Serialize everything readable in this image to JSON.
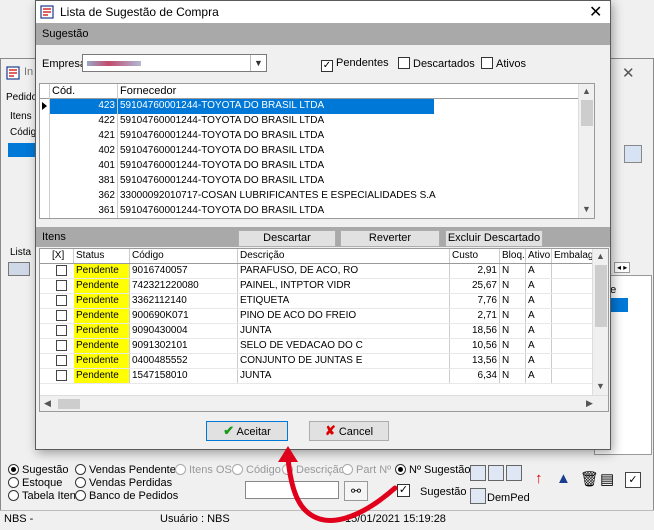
{
  "dialog": {
    "title": "Lista de Sugestão de Compra",
    "close_glyph": "✕"
  },
  "sugestao_section": {
    "label": "Sugestão",
    "empresa_label": "Empresa",
    "checkboxes": [
      {
        "label": "Pendentes",
        "checked": true
      },
      {
        "label": "Descartados",
        "checked": false
      },
      {
        "label": "Ativos",
        "checked": false
      }
    ]
  },
  "sugestoes_grid": {
    "columns": [
      "Cód. Sugestão",
      "Fornecedor"
    ],
    "rows": [
      {
        "cod": "423",
        "fornecedor": "59104760001244-TOYOTA DO BRASIL LTDA",
        "selected": true
      },
      {
        "cod": "422",
        "fornecedor": "59104760001244-TOYOTA DO BRASIL LTDA",
        "selected": false
      },
      {
        "cod": "421",
        "fornecedor": "59104760001244-TOYOTA DO BRASIL LTDA",
        "selected": false
      },
      {
        "cod": "402",
        "fornecedor": "59104760001244-TOYOTA DO BRASIL LTDA",
        "selected": false
      },
      {
        "cod": "401",
        "fornecedor": "59104760001244-TOYOTA DO BRASIL LTDA",
        "selected": false
      },
      {
        "cod": "381",
        "fornecedor": "59104760001244-TOYOTA DO BRASIL LTDA",
        "selected": false
      },
      {
        "cod": "362",
        "fornecedor": "33000092010717-COSAN LUBRIFICANTES E ESPECIALIDADES S.A",
        "selected": false
      },
      {
        "cod": "361",
        "fornecedor": "59104760001244-TOYOTA DO BRASIL LTDA",
        "selected": false
      }
    ]
  },
  "itens_section": {
    "label": "Itens",
    "buttons": {
      "descartar": "Descartar",
      "reverter": "Reverter Descartado",
      "excluir": "Excluir Descartado"
    }
  },
  "itens_grid": {
    "columns": [
      "[X]",
      "Status",
      "Código",
      "Descrição",
      "Custo",
      "Bloq.",
      "Ativo",
      "Embalage"
    ],
    "rows": [
      {
        "status": "Pendente",
        "codigo": "9016740057",
        "descricao": "PARAFUSO, DE ACO, RO",
        "custo": "2,91",
        "bloq": "N",
        "ativo": "A"
      },
      {
        "status": "Pendente",
        "codigo": "742321220080",
        "descricao": "PAINEL, INTPTOR VIDR",
        "custo": "25,67",
        "bloq": "N",
        "ativo": "A"
      },
      {
        "status": "Pendente",
        "codigo": "3362112140",
        "descricao": "ETIQUETA",
        "custo": "7,76",
        "bloq": "N",
        "ativo": "A"
      },
      {
        "status": "Pendente",
        "codigo": "900690K071",
        "descricao": "PINO DE ACO DO FREIO",
        "custo": "2,71",
        "bloq": "N",
        "ativo": "A"
      },
      {
        "status": "Pendente",
        "codigo": "9090430004",
        "descricao": "JUNTA",
        "custo": "18,56",
        "bloq": "N",
        "ativo": "A"
      },
      {
        "status": "Pendente",
        "codigo": "9091302101",
        "descricao": "SELO DE VEDACAO DO C",
        "custo": "10,56",
        "bloq": "N",
        "ativo": "A"
      },
      {
        "status": "Pendente",
        "codigo": "0400485552",
        "descricao": "CONJUNTO DE JUNTAS E",
        "custo": "13,56",
        "bloq": "N",
        "ativo": "A"
      },
      {
        "status": "Pendente",
        "codigo": "1547158010",
        "descricao": "JUNTA",
        "custo": "6,34",
        "bloq": "N",
        "ativo": "A"
      }
    ]
  },
  "footer": {
    "aceitar": "Aceitar",
    "cancel": "Cancel"
  },
  "background_window": {
    "title_fragment": "In",
    "tab_pedido": "Pedido",
    "tab_itens": "Itens",
    "col_codigo": "Códig",
    "lista_label": "Lista",
    "right_col_de": "de",
    "right_arrows": "◂ ▸",
    "radios_left": [
      {
        "label": "Sugestão",
        "on": true
      },
      {
        "label": "Estoque",
        "on": false
      },
      {
        "label": "Tabela Itens",
        "on": false
      }
    ],
    "radios_mid": [
      {
        "label": "Vendas Pendentes",
        "on": false
      },
      {
        "label": "Vendas Perdidas",
        "on": false
      },
      {
        "label": "Banco de Pedidos",
        "on": false
      }
    ],
    "itens_os": "Itens OS",
    "search_radios": [
      {
        "label": "Código",
        "on": false,
        "disabled": true
      },
      {
        "label": "Descrição",
        "on": false,
        "disabled": true
      },
      {
        "label": "Part Nº",
        "on": false,
        "disabled": true
      },
      {
        "label": "Nº Sugestão",
        "on": true,
        "disabled": false
      }
    ],
    "sugestao_check_label": "Sugestão",
    "demped_label": "DemPed"
  },
  "statusbar": {
    "left": "NBS -",
    "usuario": "Usuário : NBS",
    "datetime": "15/01/2021  15:19:28"
  },
  "colors": {
    "selection": "#0078d7",
    "status_highlight": "#ffff00",
    "section_bar": "#a9a9a9",
    "arrow": "#e0001b"
  },
  "icons": [
    "app-icon",
    "close-icon",
    "combo-arrow-icon",
    "check-icon",
    "x-icon",
    "binoculars-icon",
    "red-arrow-annotation"
  ]
}
